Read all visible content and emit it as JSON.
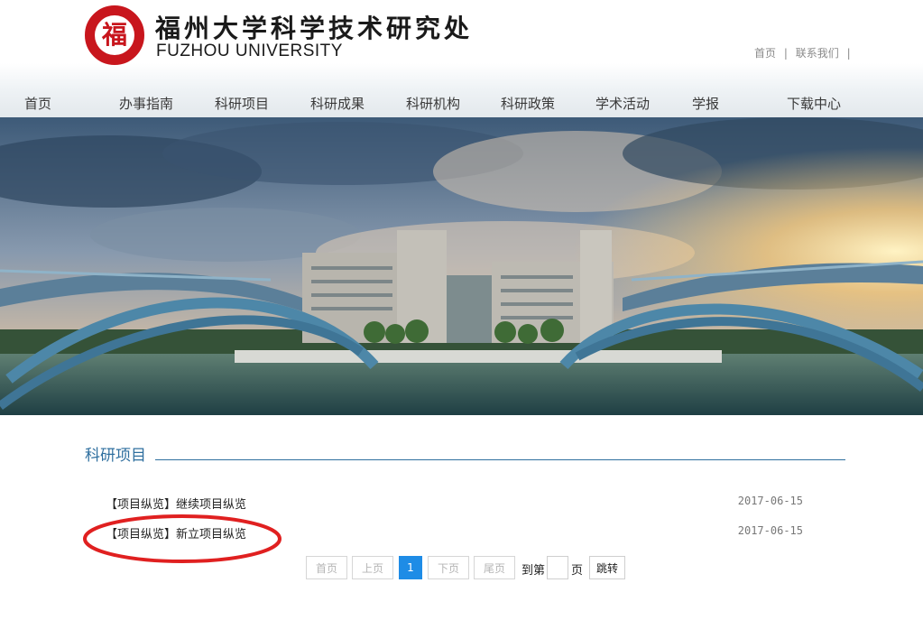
{
  "header": {
    "logo_seal_text": "福",
    "logo_cn": "福州大学科学技术研究处",
    "logo_en": "FUZHOU  UNIVERSITY",
    "top_links": [
      "首页",
      "联系我们"
    ],
    "top_link_separator": "|"
  },
  "nav": {
    "items": [
      "首页",
      "办事指南",
      "科研项目",
      "科研成果",
      "科研机构",
      "科研政策",
      "学术活动",
      "学报",
      "下载中心"
    ]
  },
  "banner": {
    "image": "campus-building-bridge-lake-photo"
  },
  "section": {
    "title": "科研项目",
    "items": [
      {
        "title": "【项目纵览】继续项目纵览",
        "date": "2017-06-15"
      },
      {
        "title": "【项目纵览】新立项目纵览",
        "date": "2017-06-15"
      }
    ]
  },
  "annotation": {
    "shape": "red-ellipse",
    "color": "#e02020"
  },
  "pagination": {
    "first": "首页",
    "prev": "上页",
    "current": "1",
    "next": "下页",
    "last": "尾页",
    "goto_prefix": "到第",
    "goto_suffix": "页",
    "goto_value": "",
    "go_button": "跳转"
  },
  "colors": {
    "accent_blue": "#2f6f9f",
    "active_page": "#1e8ce6",
    "seal_red": "#c8161d"
  }
}
